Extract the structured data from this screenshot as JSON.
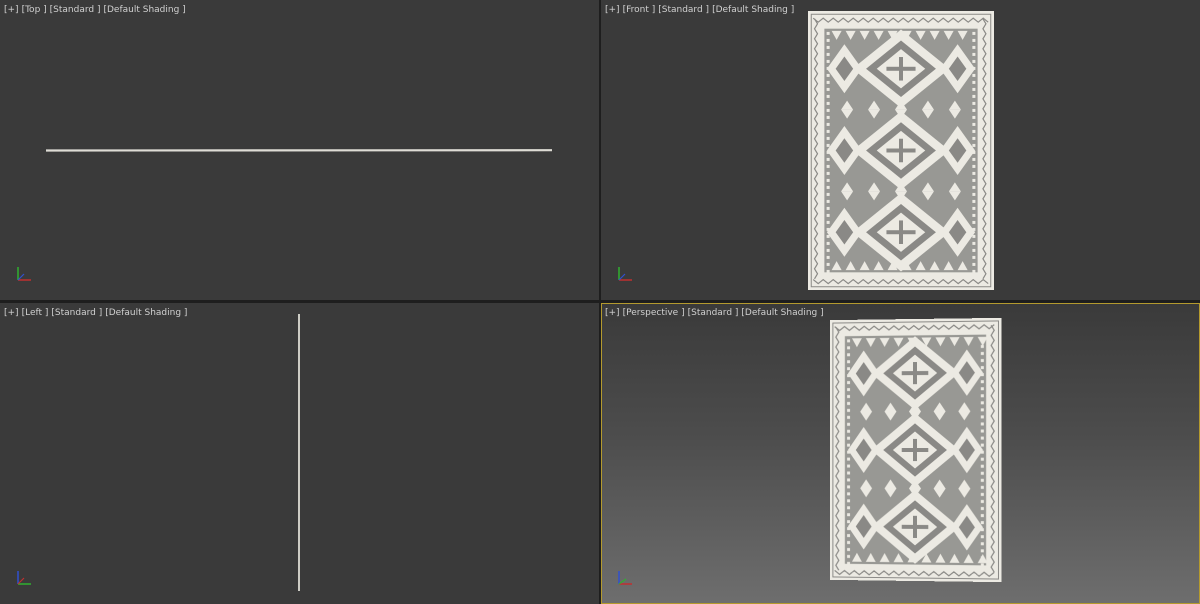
{
  "viewports": {
    "top": {
      "labels": [
        "[+]",
        "[Top ]",
        "[Standard ]",
        "[Default Shading ]"
      ],
      "active": false
    },
    "front": {
      "labels": [
        "[+]",
        "[Front ]",
        "[Standard ]",
        "[Default Shading ]"
      ],
      "active": false
    },
    "left": {
      "labels": [
        "[+]",
        "[Left ]",
        "[Standard ]",
        "[Default Shading ]"
      ],
      "active": false
    },
    "perspective": {
      "labels": [
        "[+]",
        "[Perspective ]",
        "[Standard ]",
        "[Default Shading ]"
      ],
      "active": true
    }
  },
  "colors": {
    "viewport_bg": "#3a3a3a",
    "active_border": "#b49a2e",
    "label_text": "#d0d0d0",
    "rug_light": "#eceae3",
    "rug_dark": "#8a8986",
    "axis_x": "#c03030",
    "axis_y": "#30b030",
    "axis_z": "#3050d0"
  },
  "icons": [
    "axis-gizmo-icon",
    "rug-model"
  ]
}
